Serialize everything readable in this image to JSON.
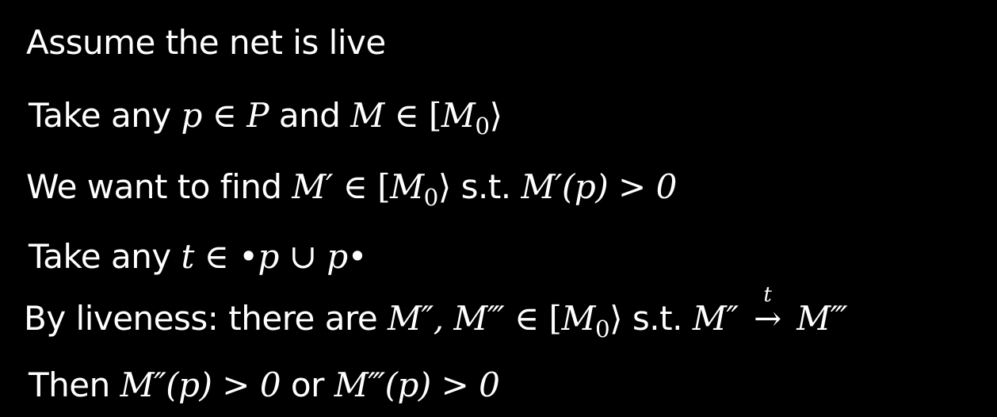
{
  "lines": {
    "l1": {
      "text": "Assume the net is live"
    },
    "l2": {
      "pre": "Take any ",
      "p": "p",
      "in1": " ∈ ",
      "P": "P",
      "and": " and ",
      "M": "M",
      "in2": " ∈ [",
      "M0": "M",
      "zero": "0",
      "close": "⟩"
    },
    "l3": {
      "pre": "We want to find ",
      "Mp": "M′",
      "in": " ∈ [",
      "M0": "M",
      "zero": "0",
      "close": "⟩",
      "st": " s.t. ",
      "expr": "M′(p) > 0"
    },
    "l4": {
      "pre": "Take any ",
      "t": "t",
      "rest": " ∈ •p ∪ p•"
    },
    "l5": {
      "pre": "By liveness: there are ",
      "Ms": "M″, M‴",
      "in": " ∈ [",
      "M0": "M",
      "zero": "0",
      "close": "⟩",
      "st": " s.t. ",
      "left": "M″",
      "arrow_label": "t",
      "arrow": "→",
      "right": "M‴"
    },
    "l6": {
      "pre": "Then ",
      "e1": "M″(p) > 0",
      "or": " or ",
      "e2": "M‴(p) > 0"
    }
  }
}
